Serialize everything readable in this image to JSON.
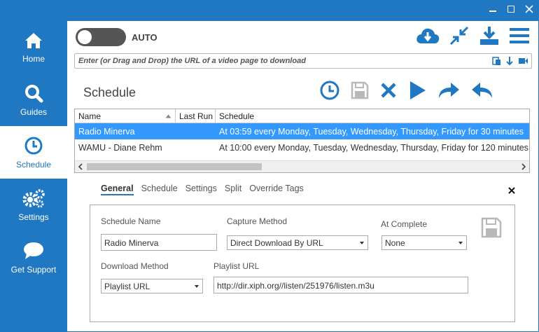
{
  "colors": {
    "accent": "#1f78c1",
    "selected_row": "#3399ff"
  },
  "nav": [
    {
      "label": "Home",
      "icon": "home-icon"
    },
    {
      "label": "Guides",
      "icon": "search-icon"
    },
    {
      "label": "Schedule",
      "icon": "clock-icon",
      "active": true
    },
    {
      "label": "Settings",
      "icon": "gears-icon"
    },
    {
      "label": "Get Support",
      "icon": "chat-bubble-icon"
    }
  ],
  "top": {
    "auto_label": "AUTO",
    "auto_enabled": false
  },
  "url_bar": {
    "placeholder": "Enter (or Drag and Drop) the URL of a video page to download"
  },
  "schedule": {
    "title": "Schedule",
    "columns": [
      "Name",
      "Last Run",
      "Schedule"
    ],
    "rows": [
      {
        "name": "Radio Minerva",
        "last_run": "",
        "schedule": "At 03:59 every Monday, Tuesday, Wednesday, Thursday, Friday for 30 minutes",
        "selected": true
      },
      {
        "name": "WAMU - Diane Rehm",
        "last_run": "",
        "schedule": "At 10:00 every Monday, Tuesday, Wednesday, Thursday, Friday for 120 minutes",
        "selected": false
      }
    ]
  },
  "tabs": [
    "General",
    "Schedule",
    "Settings",
    "Split",
    "Override Tags"
  ],
  "form": {
    "schedule_name_label": "Schedule Name",
    "schedule_name_value": "Radio Minerva",
    "capture_method_label": "Capture Method",
    "capture_method_value": "Direct Download By URL",
    "at_complete_label": "At Complete",
    "at_complete_value": "None",
    "download_method_label": "Download Method",
    "download_method_value": "Playlist URL",
    "playlist_url_label": "Playlist URL",
    "playlist_url_value": "http://dir.xiph.org//listen/251976/listen.m3u"
  }
}
